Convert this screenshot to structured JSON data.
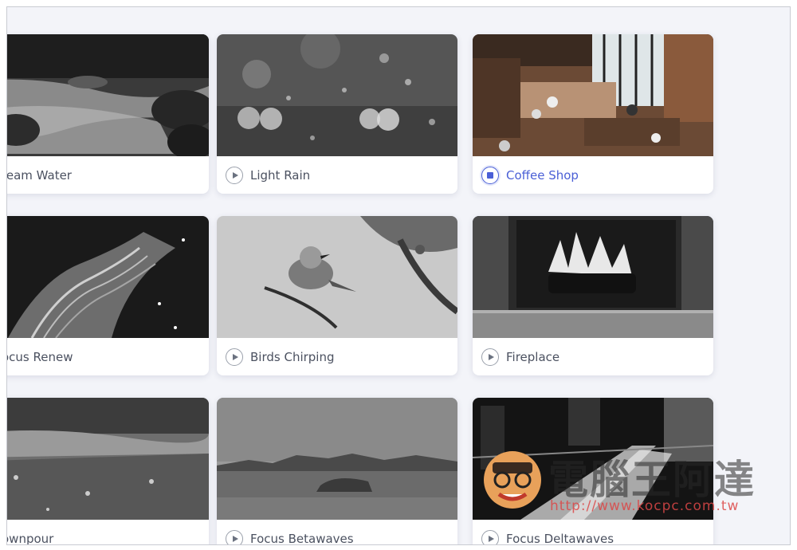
{
  "cards": [
    {
      "label": "ream Water",
      "icon": "play-icon",
      "active": false
    },
    {
      "label": "Light Rain",
      "icon": "play-icon",
      "active": false
    },
    {
      "label": "Coffee Shop",
      "icon": "stop-icon",
      "active": true
    },
    {
      "label": "ocus Renew",
      "icon": "play-icon",
      "active": false
    },
    {
      "label": "Birds Chirping",
      "icon": "play-icon",
      "active": false
    },
    {
      "label": "Fireplace",
      "icon": "play-icon",
      "active": false
    },
    {
      "label": "ownpour",
      "icon": "play-icon",
      "active": false
    },
    {
      "label": "Focus Betawaves",
      "icon": "play-icon",
      "active": false
    },
    {
      "label": "Focus Deltawaves",
      "icon": "play-icon",
      "active": false
    }
  ],
  "watermark": {
    "title": "電腦王阿達",
    "url": "http://www.kocpc.com.tw"
  },
  "colors": {
    "accent": "#4a5fd6",
    "text": "#4b5160",
    "background": "#f3f4f9"
  }
}
